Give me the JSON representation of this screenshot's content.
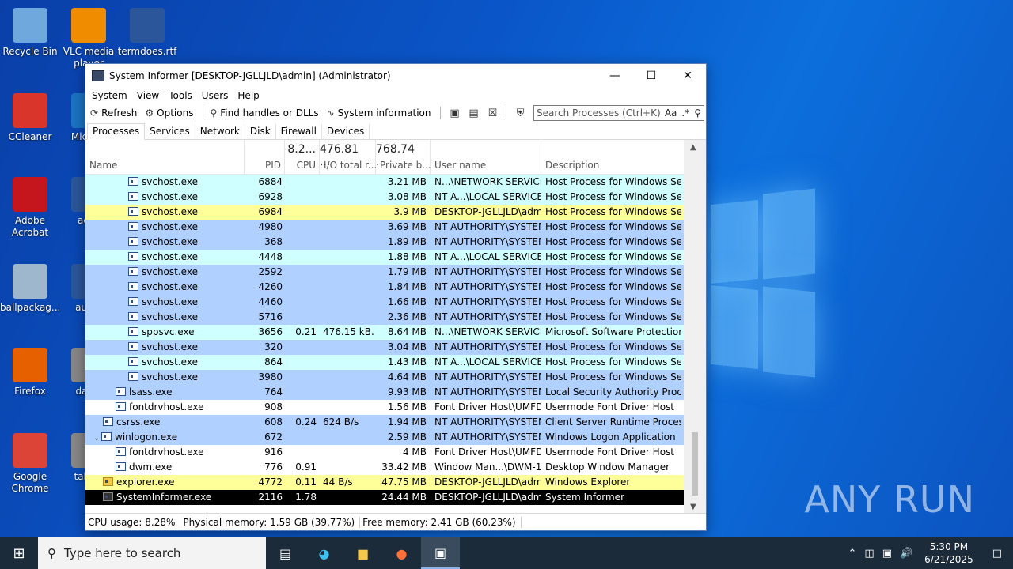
{
  "desktop": {
    "icons": [
      {
        "label": "Recycle Bin",
        "color": "#6fa8dc"
      },
      {
        "label": "VLC media player",
        "color": "#f08c00"
      },
      {
        "label": "termdoes.rtf",
        "color": "#2b579a"
      },
      {
        "label": "CCleaner",
        "color": "#d9352b"
      },
      {
        "label": "Micr Ed",
        "color": "#1b73c4"
      },
      {
        "label": "Adobe Acrobat",
        "color": "#c4161c"
      },
      {
        "label": "acco",
        "color": "#2b579a"
      },
      {
        "label": "ballpackag...",
        "color": "#9fb7cc"
      },
      {
        "label": "authc",
        "color": "#2b579a"
      },
      {
        "label": "Firefox",
        "color": "#e66000"
      },
      {
        "label": "david",
        "color": "#888888"
      },
      {
        "label": "Google Chrome",
        "color": "#db4437"
      },
      {
        "label": "tablec",
        "color": "#888888"
      }
    ],
    "watermark": "ANY RUN"
  },
  "window": {
    "title": "System Informer [DESKTOP-JGLLJLD\\admin] (Administrator)",
    "menu": [
      "System",
      "View",
      "Tools",
      "Users",
      "Help"
    ],
    "toolbar": {
      "refresh": "Refresh",
      "options": "Options",
      "find": "Find handles or DLLs",
      "sysinfo": "System information"
    },
    "search_placeholder": "Search Processes (Ctrl+K)",
    "search_opt1": "Aa",
    "search_opt2": ".*",
    "tabs": [
      "Processes",
      "Services",
      "Network",
      "Disk",
      "Firewall",
      "Devices"
    ],
    "columns": {
      "name": "Name",
      "pid": "PID",
      "cpu": "CPU",
      "cpu_total": "8.2...",
      "io": "I/O total r...",
      "io_total": "476.81 ...",
      "private": "Private b...",
      "private_total": "768.74 ...",
      "user": "User name",
      "desc": "Description"
    },
    "rows": [
      {
        "name": "svchost.exe",
        "indent": 3,
        "pid": "6884",
        "cpu": "",
        "io": "",
        "priv": "3.21 MB",
        "user": "N...\\NETWORK SERVICE",
        "desc": "Host Process for Windows Ser...",
        "bg": "#d0ffff"
      },
      {
        "name": "svchost.exe",
        "indent": 3,
        "pid": "6928",
        "cpu": "",
        "io": "",
        "priv": "3.08 MB",
        "user": "NT A...\\LOCAL SERVICE",
        "desc": "Host Process for Windows Ser...",
        "bg": "#d0ffff"
      },
      {
        "name": "svchost.exe",
        "indent": 3,
        "pid": "6984",
        "cpu": "",
        "io": "",
        "priv": "3.9 MB",
        "user": "DESKTOP-JGLLJLD\\admi",
        "desc": "Host Process for Windows Ser...",
        "bg": "#ffff99"
      },
      {
        "name": "svchost.exe",
        "indent": 3,
        "pid": "4980",
        "cpu": "",
        "io": "",
        "priv": "3.69 MB",
        "user": "NT AUTHORITY\\SYSTEM",
        "desc": "Host Process for Windows Ser...",
        "bg": "#b0d0ff"
      },
      {
        "name": "svchost.exe",
        "indent": 3,
        "pid": "368",
        "cpu": "",
        "io": "",
        "priv": "1.89 MB",
        "user": "NT AUTHORITY\\SYSTEM",
        "desc": "Host Process for Windows Ser...",
        "bg": "#b0d0ff"
      },
      {
        "name": "svchost.exe",
        "indent": 3,
        "pid": "4448",
        "cpu": "",
        "io": "",
        "priv": "1.88 MB",
        "user": "NT A...\\LOCAL SERVICE",
        "desc": "Host Process for Windows Ser...",
        "bg": "#d0ffff"
      },
      {
        "name": "svchost.exe",
        "indent": 3,
        "pid": "2592",
        "cpu": "",
        "io": "",
        "priv": "1.79 MB",
        "user": "NT AUTHORITY\\SYSTEM",
        "desc": "Host Process for Windows Ser...",
        "bg": "#b0d0ff"
      },
      {
        "name": "svchost.exe",
        "indent": 3,
        "pid": "4260",
        "cpu": "",
        "io": "",
        "priv": "1.84 MB",
        "user": "NT AUTHORITY\\SYSTEM",
        "desc": "Host Process for Windows Ser...",
        "bg": "#b0d0ff"
      },
      {
        "name": "svchost.exe",
        "indent": 3,
        "pid": "4460",
        "cpu": "",
        "io": "",
        "priv": "1.66 MB",
        "user": "NT AUTHORITY\\SYSTEM",
        "desc": "Host Process for Windows Ser...",
        "bg": "#b0d0ff"
      },
      {
        "name": "svchost.exe",
        "indent": 3,
        "pid": "5716",
        "cpu": "",
        "io": "",
        "priv": "2.36 MB",
        "user": "NT AUTHORITY\\SYSTEM",
        "desc": "Host Process for Windows Ser...",
        "bg": "#b0d0ff"
      },
      {
        "name": "sppsvc.exe",
        "indent": 3,
        "pid": "3656",
        "cpu": "0.21",
        "io": "476.15 kB...",
        "priv": "8.64 MB",
        "user": "N...\\NETWORK SERVICE",
        "desc": "Microsoft Software Protection...",
        "bg": "#d0ffff"
      },
      {
        "name": "svchost.exe",
        "indent": 3,
        "pid": "320",
        "cpu": "",
        "io": "",
        "priv": "3.04 MB",
        "user": "NT AUTHORITY\\SYSTEM",
        "desc": "Host Process for Windows Ser...",
        "bg": "#b0d0ff"
      },
      {
        "name": "svchost.exe",
        "indent": 3,
        "pid": "864",
        "cpu": "",
        "io": "",
        "priv": "1.43 MB",
        "user": "NT A...\\LOCAL SERVICE",
        "desc": "Host Process for Windows Ser...",
        "bg": "#d0ffff"
      },
      {
        "name": "svchost.exe",
        "indent": 3,
        "pid": "3980",
        "cpu": "",
        "io": "",
        "priv": "4.64 MB",
        "user": "NT AUTHORITY\\SYSTEM",
        "desc": "Host Process for Windows Ser...",
        "bg": "#b0d0ff"
      },
      {
        "name": "lsass.exe",
        "indent": 2,
        "pid": "764",
        "cpu": "",
        "io": "",
        "priv": "9.93 MB",
        "user": "NT AUTHORITY\\SYSTEM",
        "desc": "Local Security Authority Proce...",
        "bg": "#b0d0ff"
      },
      {
        "name": "fontdrvhost.exe",
        "indent": 2,
        "pid": "908",
        "cpu": "",
        "io": "",
        "priv": "1.56 MB",
        "user": "Font Driver Host\\UMFD-",
        "desc": "Usermode Font Driver Host",
        "bg": "#ffffff"
      },
      {
        "name": "csrss.exe",
        "indent": 1,
        "pid": "608",
        "cpu": "0.24",
        "io": "624 B/s",
        "priv": "1.94 MB",
        "user": "NT AUTHORITY\\SYSTEM",
        "desc": "Client Server Runtime Process",
        "bg": "#b0d0ff"
      },
      {
        "name": "winlogon.exe",
        "indent": 1,
        "twisty": "expanded",
        "pid": "672",
        "cpu": "",
        "io": "",
        "priv": "2.59 MB",
        "user": "NT AUTHORITY\\SYSTEM",
        "desc": "Windows Logon Application",
        "bg": "#b0d0ff"
      },
      {
        "name": "fontdrvhost.exe",
        "indent": 2,
        "pid": "916",
        "cpu": "",
        "io": "",
        "priv": "4 MB",
        "user": "Font Driver Host\\UMFD-",
        "desc": "Usermode Font Driver Host",
        "bg": "#ffffff"
      },
      {
        "name": "dwm.exe",
        "indent": 2,
        "pid": "776",
        "cpu": "0.91",
        "io": "",
        "priv": "33.42 MB",
        "user": "Window Man...\\DWM-1",
        "desc": "Desktop Window Manager",
        "bg": "#ffffff"
      },
      {
        "name": "explorer.exe",
        "indent": 1,
        "icon": "folder",
        "pid": "4772",
        "cpu": "0.11",
        "io": "44 B/s",
        "priv": "47.75 MB",
        "user": "DESKTOP-JGLLJLD\\admi",
        "desc": "Windows Explorer",
        "bg": "#ffff99"
      },
      {
        "name": "SystemInformer.exe",
        "indent": 1,
        "icon": "dark",
        "pid": "2116",
        "cpu": "1.78",
        "io": "",
        "priv": "24.44 MB",
        "user": "DESKTOP-JGLLJLD\\admi",
        "desc": "System Informer",
        "bg": "#000000",
        "fg": "#ffffff",
        "selected": true
      }
    ],
    "status": {
      "cpu": "CPU usage: 8.28%",
      "phys": "Physical memory: 1.59 GB (39.77%)",
      "free": "Free memory: 2.41 GB (60.23%)"
    }
  },
  "taskbar": {
    "search_placeholder": "Type here to search",
    "time": "5:30 PM",
    "date": "6/21/2025"
  }
}
